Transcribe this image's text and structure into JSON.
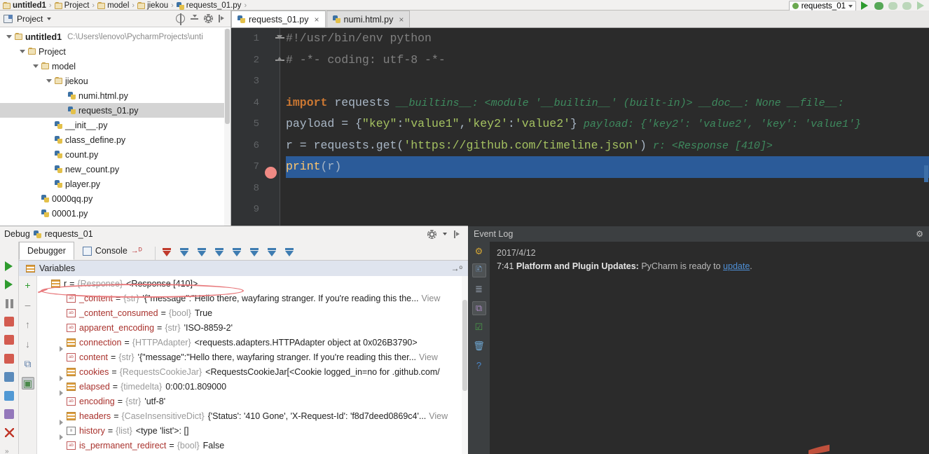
{
  "breadcrumb": {
    "items": [
      {
        "label": "untitled1",
        "icon": "folder-icon",
        "bold": true
      },
      {
        "label": "Project",
        "icon": "folder-icon",
        "bold": false
      },
      {
        "label": "model",
        "icon": "folder-icon",
        "bold": false
      },
      {
        "label": "jiekou",
        "icon": "folder-icon",
        "bold": false
      },
      {
        "label": "requests_01.py",
        "icon": "python-file-icon",
        "bold": false
      }
    ],
    "separator": "›"
  },
  "run_config": {
    "name": "requests_01",
    "dropdown_icon": "chevron-down-icon",
    "buttons": [
      {
        "name": "run-button",
        "icon": "run-icon"
      },
      {
        "name": "debug-button",
        "icon": "debug-icon"
      },
      {
        "name": "coverage-button",
        "icon": "coverage-icon"
      },
      {
        "name": "rerun-button",
        "icon": "rerun-icon"
      },
      {
        "name": "resume-button",
        "icon": "resume-icon"
      }
    ]
  },
  "project_panel": {
    "title": "Project",
    "panel_icon": "project-view-icon",
    "tools": [
      {
        "name": "scroll-from-source-icon"
      },
      {
        "name": "collapse-all-icon"
      },
      {
        "name": "settings-gear-icon"
      },
      {
        "name": "hide-panel-icon"
      }
    ],
    "tree": [
      {
        "label": "untitled1",
        "path": "C:\\Users\\lenovo\\PycharmProjects\\unti",
        "indent": 0,
        "icon": "folder-icon",
        "expanded": true,
        "bold": true,
        "selected": false
      },
      {
        "label": "Project",
        "path": "",
        "indent": 1,
        "icon": "folder-icon",
        "expanded": true,
        "bold": false,
        "selected": false
      },
      {
        "label": "model",
        "path": "",
        "indent": 2,
        "icon": "folder-icon",
        "expanded": true,
        "bold": false,
        "selected": false
      },
      {
        "label": "jiekou",
        "path": "",
        "indent": 3,
        "icon": "folder-icon",
        "expanded": true,
        "bold": false,
        "selected": false
      },
      {
        "label": "numi.html.py",
        "path": "",
        "indent": 4,
        "icon": "python-file-icon",
        "expanded": false,
        "bold": false,
        "selected": false
      },
      {
        "label": "requests_01.py",
        "path": "",
        "indent": 4,
        "icon": "python-file-icon",
        "expanded": false,
        "bold": false,
        "selected": true
      },
      {
        "label": "__init__.py",
        "path": "",
        "indent": 3,
        "icon": "python-file-icon",
        "expanded": false,
        "bold": false,
        "selected": false
      },
      {
        "label": "class_define.py",
        "path": "",
        "indent": 3,
        "icon": "python-file-icon",
        "expanded": false,
        "bold": false,
        "selected": false
      },
      {
        "label": "count.py",
        "path": "",
        "indent": 3,
        "icon": "python-file-icon",
        "expanded": false,
        "bold": false,
        "selected": false
      },
      {
        "label": "new_count.py",
        "path": "",
        "indent": 3,
        "icon": "python-file-icon",
        "expanded": false,
        "bold": false,
        "selected": false
      },
      {
        "label": "player.py",
        "path": "",
        "indent": 3,
        "icon": "python-file-icon",
        "expanded": false,
        "bold": false,
        "selected": false
      },
      {
        "label": "0000qq.py",
        "path": "",
        "indent": 2,
        "icon": "python-file-icon",
        "expanded": false,
        "bold": false,
        "selected": false
      },
      {
        "label": "00001.py",
        "path": "",
        "indent": 2,
        "icon": "python-file-icon",
        "expanded": false,
        "bold": false,
        "selected": false
      }
    ]
  },
  "editor": {
    "tabs": [
      {
        "label": "requests_01.py",
        "active": true,
        "icon": "python-file-icon",
        "close": "×"
      },
      {
        "label": "numi.html.py",
        "active": false,
        "icon": "python-file-icon",
        "close": "×"
      }
    ],
    "line_numbers": [
      "1",
      "2",
      "3",
      "4",
      "5",
      "6",
      "7",
      "8",
      "9"
    ],
    "breakpoint_line": 7,
    "current_line": 7,
    "lines": [
      {
        "n": 1,
        "tokens": [
          {
            "t": "#!/usr/bin/env python",
            "c": "cmt"
          }
        ],
        "debug": ""
      },
      {
        "n": 2,
        "tokens": [
          {
            "t": "# -*- coding: utf-8 -*-",
            "c": "cmt"
          }
        ],
        "debug": ""
      },
      {
        "n": 3,
        "tokens": [],
        "debug": ""
      },
      {
        "n": 4,
        "tokens": [
          {
            "t": "import",
            "c": "kw"
          },
          {
            "t": " requests",
            "c": "txt"
          }
        ],
        "debug": "__builtins__: <module '__builtin__' (built-in)>  __doc__: None  __file__:"
      },
      {
        "n": 5,
        "tokens": [
          {
            "t": "payload = {",
            "c": "txt"
          },
          {
            "t": "\"key\"",
            "c": "str"
          },
          {
            "t": ":",
            "c": "txt"
          },
          {
            "t": "\"value1\"",
            "c": "str"
          },
          {
            "t": ",",
            "c": "txt"
          },
          {
            "t": "'key2'",
            "c": "str"
          },
          {
            "t": ":",
            "c": "txt"
          },
          {
            "t": "'value2'",
            "c": "str"
          },
          {
            "t": "}",
            "c": "txt"
          }
        ],
        "debug": "payload: {'key2': 'value2', 'key': 'value1'}"
      },
      {
        "n": 6,
        "tokens": [
          {
            "t": "r = requests.get(",
            "c": "txt"
          },
          {
            "t": "'https://github.com/timeline.json'",
            "c": "str"
          },
          {
            "t": ")",
            "c": "txt"
          }
        ],
        "debug": "r: <Response [410]>"
      },
      {
        "n": 7,
        "tokens": [
          {
            "t": "print",
            "c": "fn"
          },
          {
            "t": "(r)",
            "c": "txt"
          }
        ],
        "debug": ""
      },
      {
        "n": 8,
        "tokens": [],
        "debug": ""
      },
      {
        "n": 9,
        "tokens": [],
        "debug": ""
      }
    ]
  },
  "debug_panel": {
    "title": "Debug",
    "config_name": "requests_01",
    "config_icon": "python-debug-icon",
    "header_tools": [
      {
        "name": "settings-gear-icon"
      },
      {
        "name": "hide-panel-icon"
      }
    ],
    "tabs": [
      {
        "label": "Debugger",
        "active": true,
        "icon": ""
      },
      {
        "label": "Console",
        "active": false,
        "icon": "console-icon"
      }
    ],
    "console_pin": "→ᴰ",
    "step_buttons": [
      {
        "name": "show-execution-point-button",
        "icon": "execution-point-icon"
      },
      {
        "name": "step-over-button",
        "icon": "step-over-icon"
      },
      {
        "name": "step-into-button",
        "icon": "step-into-icon"
      },
      {
        "name": "force-step-into-button",
        "icon": "force-step-into-icon"
      },
      {
        "name": "step-out-button",
        "icon": "step-out-icon"
      },
      {
        "name": "run-to-cursor-button",
        "icon": "run-to-cursor-icon"
      },
      {
        "name": "evaluate-expression-button",
        "icon": "evaluate-expression-icon"
      },
      {
        "name": "view-breakpoints-button",
        "icon": "breakpoints-icon"
      }
    ],
    "left_rail": [
      {
        "name": "rerun-debug-button",
        "icon": "rerun-icon"
      },
      {
        "name": "resume-program-button",
        "icon": "resume-icon"
      },
      {
        "name": "pause-program-button",
        "icon": "pause-icon"
      },
      {
        "name": "stop-button",
        "icon": "stop-icon"
      },
      {
        "name": "view-breakpoints-button",
        "icon": "breakpoints-icon"
      },
      {
        "name": "mute-breakpoints-button",
        "icon": "mute-breakpoints-icon"
      },
      {
        "name": "restore-layout-button",
        "icon": "layout-icon"
      },
      {
        "name": "settings-button",
        "icon": "gear-icon"
      },
      {
        "name": "pin-tab-button",
        "icon": "pin-icon"
      },
      {
        "name": "close-button",
        "icon": "close-icon"
      },
      {
        "name": "expand-rail-button",
        "icon": "chevrons-icon"
      }
    ],
    "vars_rail": [
      {
        "name": "add-watch-button",
        "icon": "plus-icon"
      },
      {
        "name": "remove-watch-button",
        "icon": "minus-icon"
      },
      {
        "name": "move-up-button",
        "icon": "arrow-up-icon"
      },
      {
        "name": "move-down-button",
        "icon": "arrow-down-icon"
      },
      {
        "name": "copy-value-button",
        "icon": "copy-icon"
      },
      {
        "name": "inspect-button",
        "icon": "inspect-icon"
      }
    ],
    "variables_label": "Variables",
    "variables": [
      {
        "expandable": false,
        "icon": "object-icon",
        "name": "r",
        "type": "{Response}",
        "value": "<Response [410]>",
        "view": "",
        "indent": 0,
        "root": true
      },
      {
        "expandable": false,
        "icon": "string-icon",
        "name": "_content",
        "type": "{str}",
        "value": "'{\"message\":\"Hello there, wayfaring stranger. If you're reading this the...",
        "view": "View",
        "indent": 1,
        "root": false
      },
      {
        "expandable": false,
        "icon": "string-icon",
        "name": "_content_consumed",
        "type": "{bool}",
        "value": "True",
        "view": "",
        "indent": 1,
        "root": false
      },
      {
        "expandable": false,
        "icon": "string-icon",
        "name": "apparent_encoding",
        "type": "{str}",
        "value": "'ISO-8859-2'",
        "view": "",
        "indent": 1,
        "root": false
      },
      {
        "expandable": true,
        "icon": "object-icon",
        "name": "connection",
        "type": "{HTTPAdapter}",
        "value": "<requests.adapters.HTTPAdapter object at 0x026B3790>",
        "view": "",
        "indent": 1,
        "root": false
      },
      {
        "expandable": false,
        "icon": "string-icon",
        "name": "content",
        "type": "{str}",
        "value": "'{\"message\":\"Hello there, wayfaring stranger. If you're reading this ther...",
        "view": "View",
        "indent": 1,
        "root": false
      },
      {
        "expandable": true,
        "icon": "object-icon",
        "name": "cookies",
        "type": "{RequestsCookieJar}",
        "value": "<RequestsCookieJar[<Cookie logged_in=no for .github.com/",
        "view": "",
        "indent": 1,
        "root": false
      },
      {
        "expandable": true,
        "icon": "object-icon",
        "name": "elapsed",
        "type": "{timedelta}",
        "value": "0:00:01.809000",
        "view": "",
        "indent": 1,
        "root": false
      },
      {
        "expandable": false,
        "icon": "string-icon",
        "name": "encoding",
        "type": "{str}",
        "value": "'utf-8'",
        "view": "",
        "indent": 1,
        "root": false
      },
      {
        "expandable": true,
        "icon": "object-icon",
        "name": "headers",
        "type": "{CaseInsensitiveDict}",
        "value": "{'Status': '410 Gone', 'X-Request-Id': 'f8d7deed0869c4'...",
        "view": "View",
        "indent": 1,
        "root": false
      },
      {
        "expandable": true,
        "icon": "list-icon",
        "name": "history",
        "type": "{list}",
        "value": "<type 'list'>: []",
        "view": "",
        "indent": 1,
        "root": false
      },
      {
        "expandable": false,
        "icon": "string-icon",
        "name": "is_permanent_redirect",
        "type": "{bool}",
        "value": "False",
        "view": "",
        "indent": 1,
        "root": false
      }
    ]
  },
  "event_log": {
    "title": "Event Log",
    "gear_icon": "gear-icon",
    "rail": [
      {
        "name": "settings-icon"
      },
      {
        "name": "notifications-icon"
      },
      {
        "name": "expand-icon"
      },
      {
        "name": "copy-icon"
      },
      {
        "name": "mark-read-icon"
      },
      {
        "name": "clear-all-icon"
      },
      {
        "name": "help-icon"
      }
    ],
    "entries": [
      {
        "date": "2017/4/12",
        "time": "7:41",
        "category": "Platform and Plugin Updates:",
        "message": "PyCharm is ready to",
        "link": "update",
        "suffix": "."
      }
    ]
  },
  "colors": {
    "accent_blue": "#2b5b99",
    "editor_bg": "#2b2b2b",
    "gutter_bg": "#313335",
    "panel_bg": "#f2f1f0",
    "breakpoint_red": "#f08a84",
    "annotation_red": "#e8797c",
    "link_blue": "#4e8fd6",
    "keyword_orange": "#cc7832",
    "string_green": "#a5c261",
    "inline_debug_green": "#3e8a5e"
  }
}
